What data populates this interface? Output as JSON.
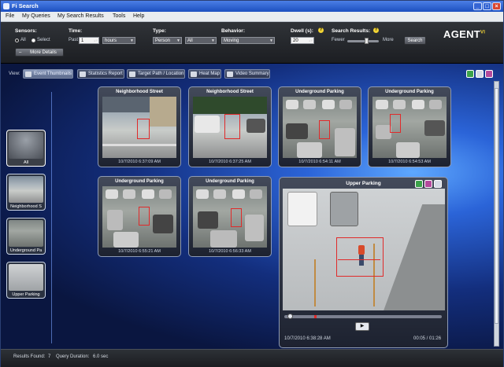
{
  "window": {
    "title": "Fi Search",
    "minimize": "_",
    "maximize": "□",
    "close": "×"
  },
  "menu": [
    "File",
    "My Queries",
    "My Search Results",
    "Tools",
    "Help"
  ],
  "filters": {
    "sensors": {
      "label": "Sensors:",
      "all": "All",
      "select": "Select",
      "selected": "Select"
    },
    "time": {
      "label": "Time:",
      "past_label": "Past",
      "value": "1",
      "unit": "hours"
    },
    "type": {
      "label": "Type:",
      "value": "Person",
      "sub_value": "All"
    },
    "behavior": {
      "label": "Behavior:",
      "value": "Moving"
    },
    "dwell": {
      "label": "Dwell (s):",
      "value": "20"
    },
    "search_results": {
      "label": "Search Results:",
      "fewer": "Fewer",
      "more": "More",
      "level": 0.6
    },
    "search_button": "Search",
    "more_details": "More Details"
  },
  "logo": {
    "text": "AGENT",
    "suffix": "VI"
  },
  "view": {
    "label": "View:",
    "buttons": [
      "Event Thumbnails",
      "Statistics Report",
      "Target Path / Location",
      "Heat Map",
      "Video Summary"
    ],
    "active": "Event Thumbnails"
  },
  "sensors_list": [
    {
      "label": "All"
    },
    {
      "label": "Neighborhood S"
    },
    {
      "label": "Underground Pa"
    },
    {
      "label": "Upper Parking"
    }
  ],
  "thumbnails": [
    {
      "title": "Neighborhood Street",
      "time": "10/7/2010 6:37:09 AM"
    },
    {
      "title": "Neighborhood Street",
      "time": "10/7/2010 6:37:25 AM"
    },
    {
      "title": "Underground Parking",
      "time": "10/7/2010 6:54:11 AM"
    },
    {
      "title": "Underground Parking",
      "time": "10/7/2010 6:54:53 AM"
    },
    {
      "title": "Underground Parking",
      "time": "10/7/2010 6:55:21 AM"
    },
    {
      "title": "Underground Parking",
      "time": "10/7/2010 6:56:33 AM"
    }
  ],
  "player": {
    "title": "Upper Parking",
    "timestamp": "10/7/2010 6:38:28 AM",
    "elapsed": "00:05 / 01:26",
    "progress": 0.06
  },
  "status": {
    "results_found_label": "Results Found:",
    "results_found": "7",
    "query_duration_label": "Query Duration:",
    "query_duration": "6.0 sec"
  },
  "colors": {
    "accent": "#2b64d8",
    "detection_box": "#e02a2a",
    "help": "#f0d234"
  }
}
